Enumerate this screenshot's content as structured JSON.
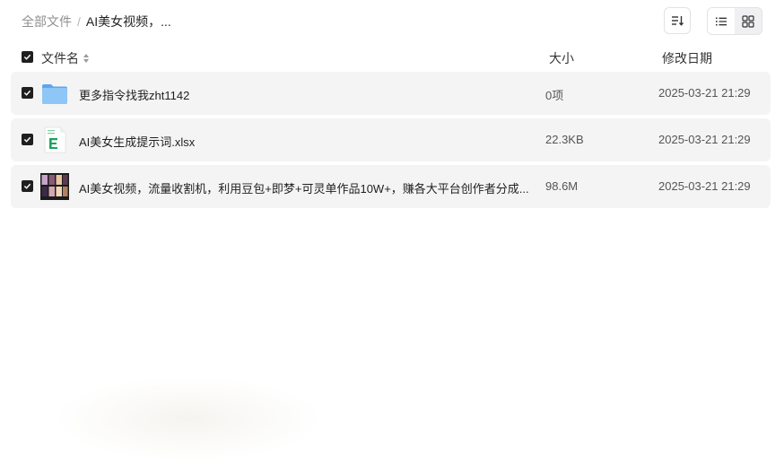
{
  "breadcrumb": {
    "root": "全部文件",
    "separator": "/",
    "current": "AI美女视频，..."
  },
  "toolbar": {
    "sort_icon": "sort-icon",
    "list_view_icon": "list-view-icon",
    "grid_view_icon": "grid-view-icon"
  },
  "header": {
    "name": "文件名",
    "size": "大小",
    "date": "修改日期"
  },
  "files": [
    {
      "name": "更多指令找我zht1142",
      "size": "0项",
      "date": "2025-03-21 21:29",
      "type": "folder"
    },
    {
      "name": "AI美女生成提示词.xlsx",
      "size": "22.3KB",
      "date": "2025-03-21 21:29",
      "type": "excel"
    },
    {
      "name": "AI美女视频，流量收割机，利用豆包+即梦+可灵单作品10W+，赚各大平台创作者分成...",
      "size": "98.6M",
      "date": "2025-03-21 21:29",
      "type": "video"
    }
  ],
  "colors": {
    "row_bg": "#f4f4f5",
    "checkbox": "#1f1f1f",
    "excel_green": "#1aa260",
    "folder_blue": "#6fb3f2"
  }
}
